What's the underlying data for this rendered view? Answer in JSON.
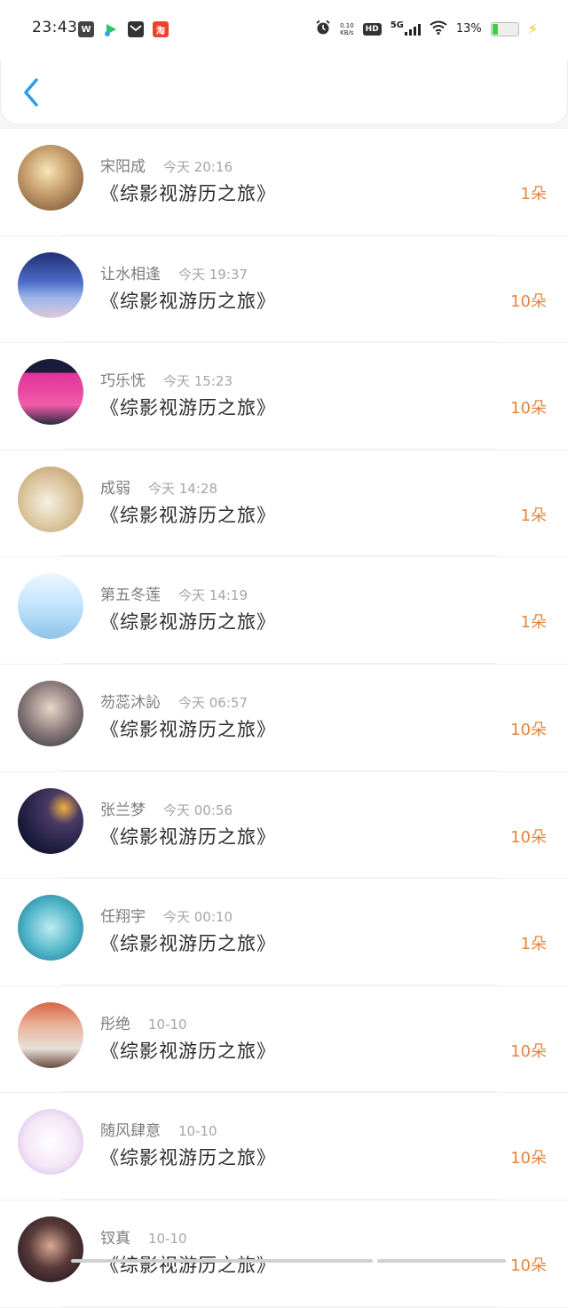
{
  "status": {
    "time": "23:43",
    "net_speed_value": "0.10",
    "net_speed_unit": "KB/s",
    "hd": "HD",
    "network": "5G",
    "battery": "13%",
    "battery_level": 0.13,
    "left_icons": [
      "wps-app-icon",
      "video-app-icon",
      "mail-app-icon",
      "taobao-app-icon"
    ]
  },
  "nav": {
    "back_icon": "chevron-left-icon",
    "accent": "#2a9fe8"
  },
  "book_title": "《综影视游历之旅》",
  "colors": {
    "count": "#e8843a"
  },
  "items": [
    {
      "name": "宋阳成",
      "time": "今天 20:16",
      "count": "1朵"
    },
    {
      "name": "让水相逢",
      "time": "今天 19:37",
      "count": "10朵"
    },
    {
      "name": "巧乐怃",
      "time": "今天 15:23",
      "count": "10朵"
    },
    {
      "name": "成弱",
      "time": "今天 14:28",
      "count": "1朵"
    },
    {
      "name": "第五冬莲",
      "time": "今天 14:19",
      "count": "1朵"
    },
    {
      "name": "芴蕊沐訫",
      "time": "今天 06:57",
      "count": "10朵"
    },
    {
      "name": "张兰梦",
      "time": "今天 00:56",
      "count": "10朵"
    },
    {
      "name": "任翔宇",
      "time": "今天 00:10",
      "count": "1朵"
    },
    {
      "name": "彤绝",
      "time": "10-10",
      "count": "10朵"
    },
    {
      "name": "随风肆意",
      "time": "10-10",
      "count": "10朵"
    },
    {
      "name": "钗真",
      "time": "10-10",
      "count": "10朵"
    }
  ]
}
